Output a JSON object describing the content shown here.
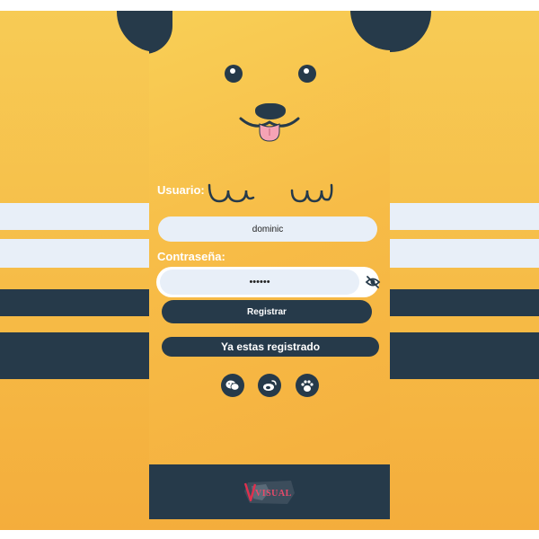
{
  "form": {
    "username_label": "Usuario:",
    "username_value": "dominic",
    "password_label": "Contraseña:",
    "password_value": "••••••"
  },
  "buttons": {
    "register": "Registrar",
    "already_registered": "Ya estas registrado"
  },
  "social": [
    "wechat-icon",
    "weibo-icon",
    "paw-icon"
  ],
  "footer": {
    "logo_text": "VISUAL"
  },
  "colors": {
    "primary": "#263a4a",
    "accent": "#f6ba45",
    "input_bg": "#e8eff8",
    "tongue": "#f5a3b5"
  }
}
